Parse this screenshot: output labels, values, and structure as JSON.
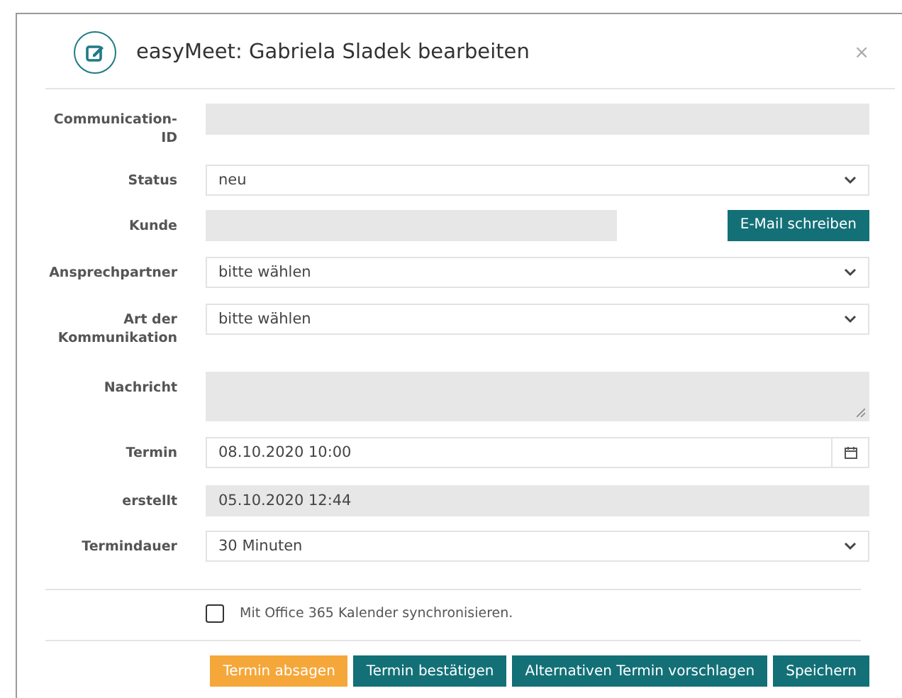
{
  "dialog": {
    "title": "easyMeet: Gabriela Sladek bearbeiten",
    "close": "×"
  },
  "fields": [
    {
      "label": "Communication-ID",
      "kind": "readonly"
    },
    {
      "label": "Status",
      "kind": "select",
      "value": "neu"
    },
    {
      "label": "Kunde",
      "kind": "readonly",
      "button": "E-Mail schreiben"
    },
    {
      "label": "Ansprechpartner",
      "kind": "select",
      "value": "bitte wählen"
    },
    {
      "label": "Art der Kommunikation",
      "kind": "select",
      "value": "bitte wählen"
    },
    {
      "label": "Nachricht",
      "kind": "textarea"
    },
    {
      "label": "Termin",
      "kind": "date",
      "value": "08.10.2020 10:00"
    },
    {
      "label": "erstellt",
      "kind": "readonly",
      "value": "05.10.2020 12:44"
    },
    {
      "label": "Termindauer",
      "kind": "select",
      "value": "30 Minuten"
    }
  ],
  "sync": {
    "label": "Mit Office 365 Kalender synchronisieren.",
    "checked": false
  },
  "buttons": [
    {
      "label": "Termin absagen",
      "kind": "warning"
    },
    {
      "label": "Termin bestätigen",
      "kind": "primary"
    },
    {
      "label": "Alternativen Termin vorschlagen",
      "kind": "primary"
    },
    {
      "label": "Speichern",
      "kind": "primary"
    }
  ]
}
